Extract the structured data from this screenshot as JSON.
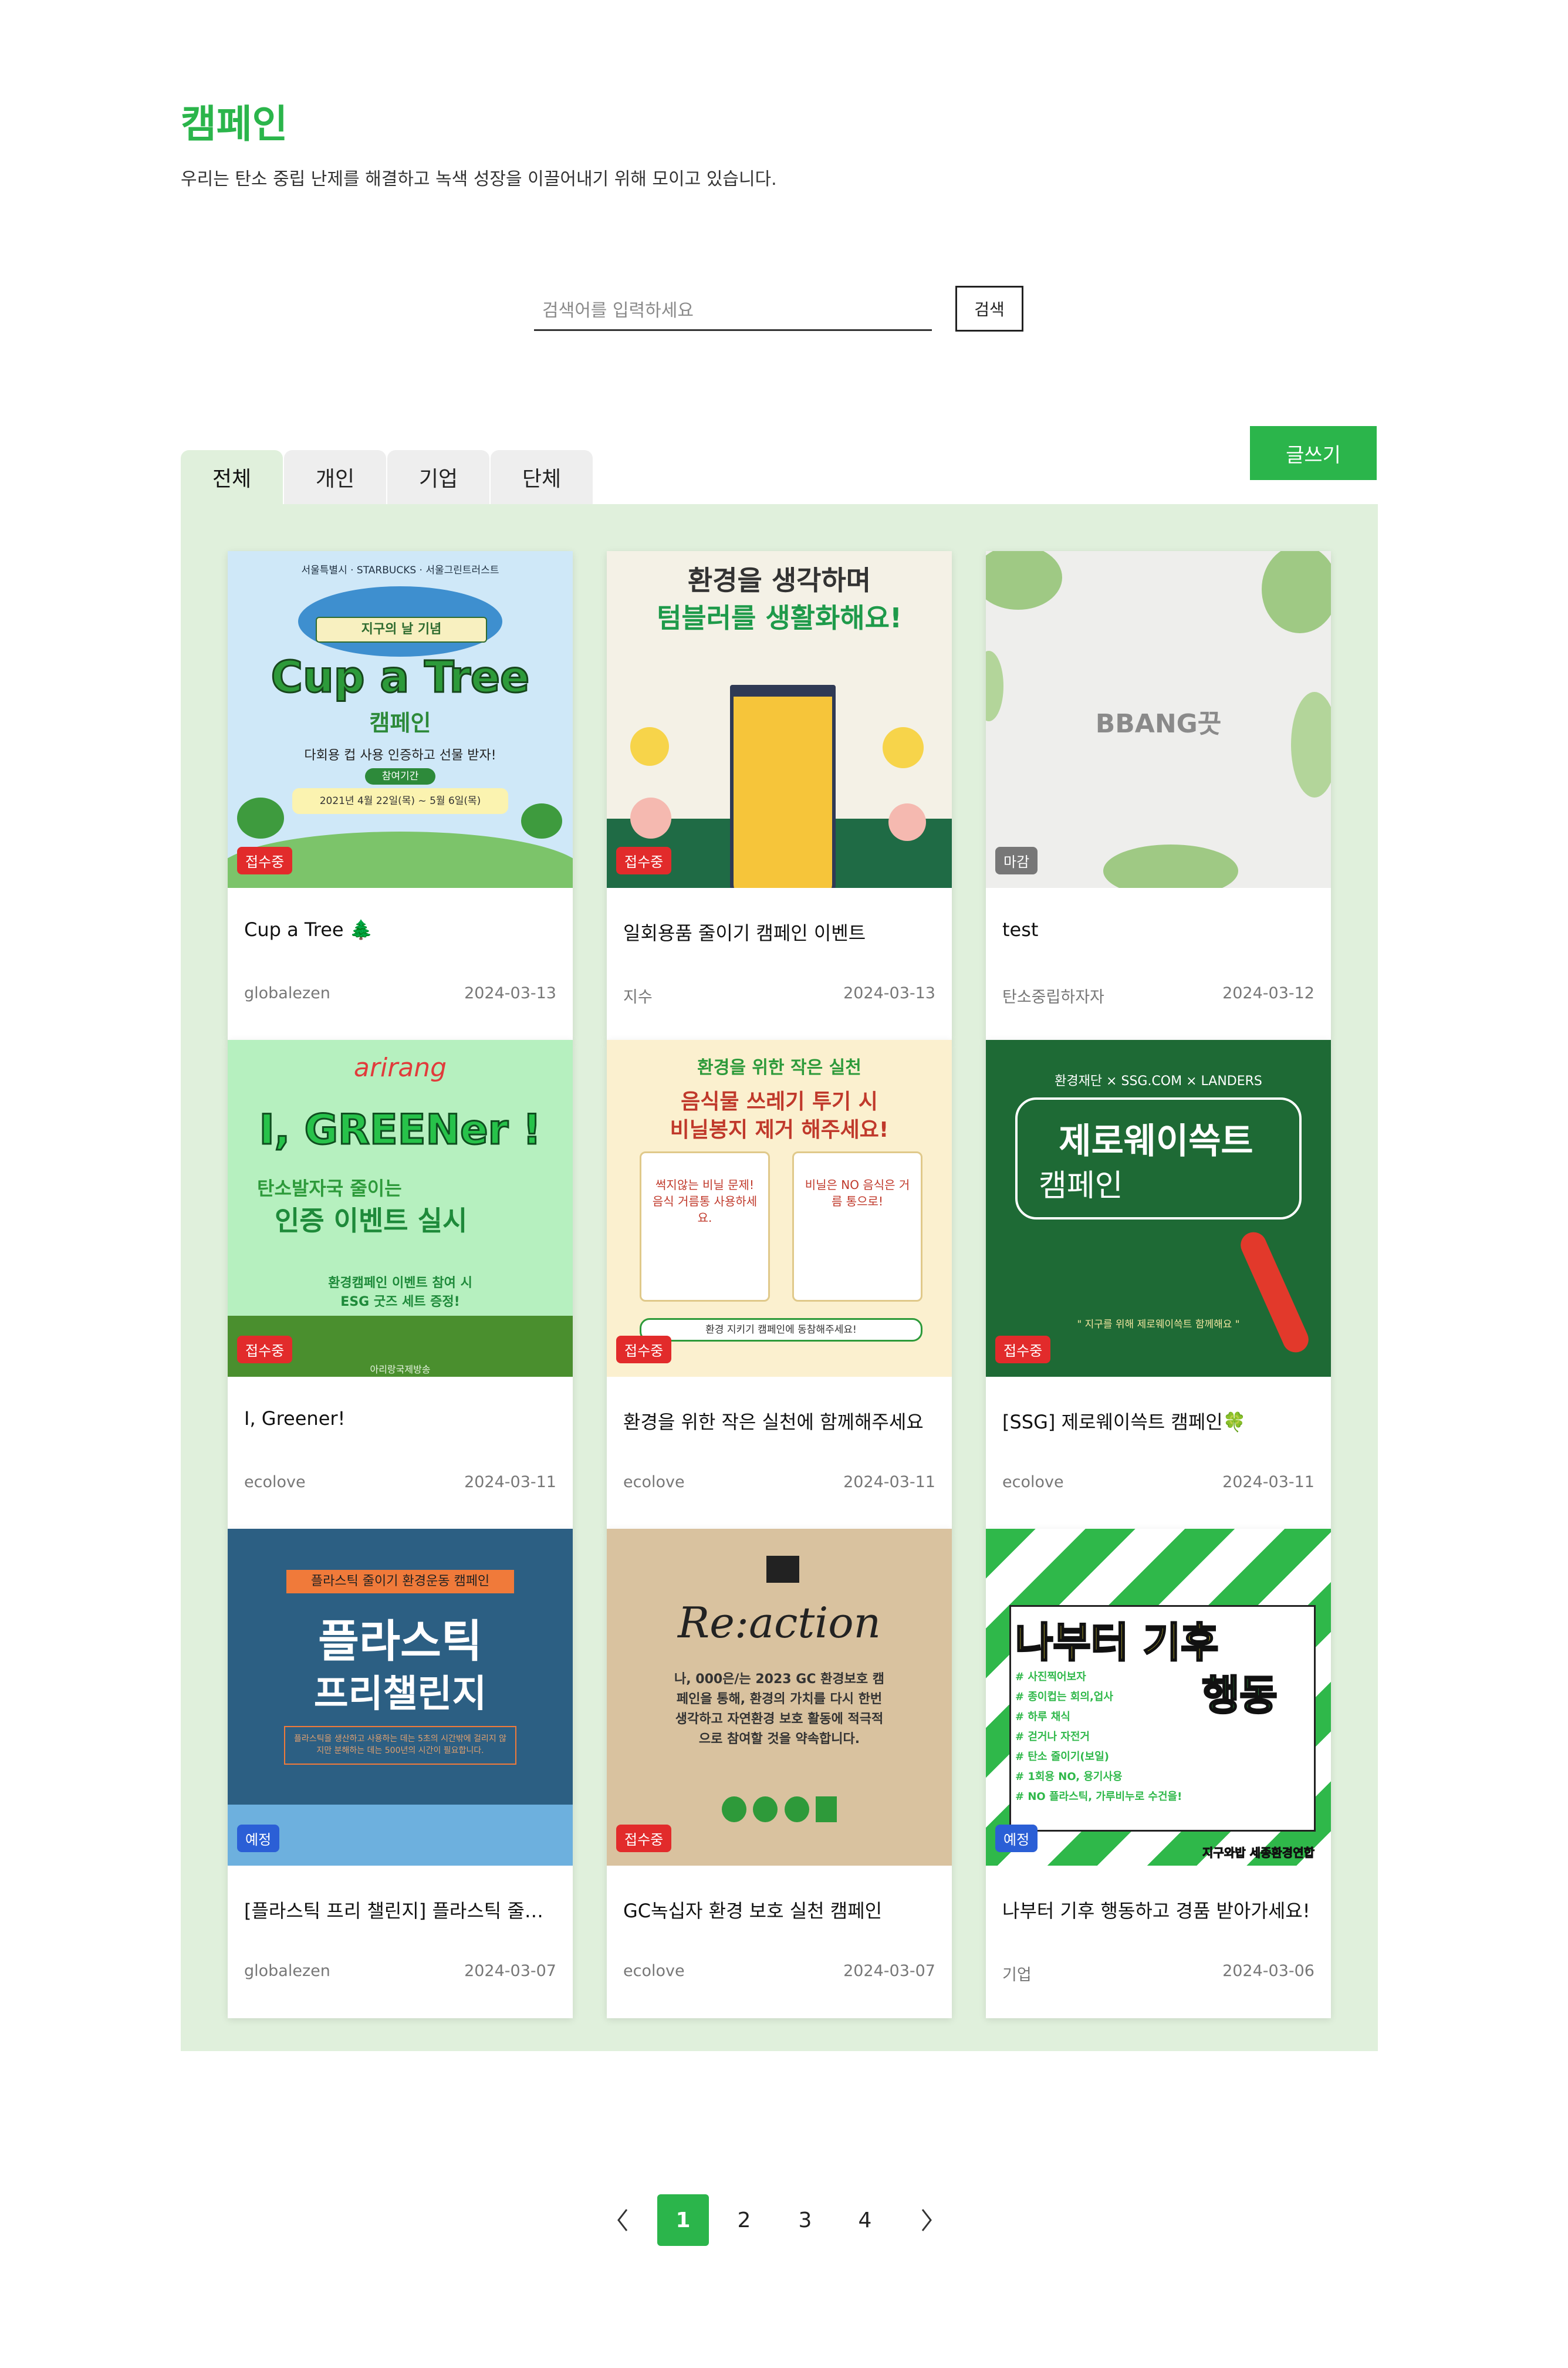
{
  "header": {
    "title": "캠페인",
    "subtitle": "우리는 탄소 중립 난제를 해결하고 녹색 성장을 이끌어내기 위해 모이고 있습니다."
  },
  "search": {
    "placeholder": "검색어를 입력하세요",
    "button": "검색"
  },
  "write_button": "글쓰기",
  "tabs": [
    "전체",
    "개인",
    "기업",
    "단체"
  ],
  "active_tab": "전체",
  "colors": {
    "accent": "#2bb54b",
    "panel": "#e0f0dc",
    "badge_open": "#e22b2b",
    "badge_closed": "#777777",
    "badge_planned": "#2b5fd6"
  },
  "cards": [
    {
      "status": "접수중",
      "title": "Cup a Tree 🌲",
      "author": "globalezen",
      "date": "2024-03-13",
      "thumb": {
        "logos": "서울특별시 · STARBUCKS · 서울그린트러스트",
        "ribbon": "지구의 날 기념",
        "headline": "Cup a Tree",
        "sub": "캠페인",
        "desc": "다회용 컵 사용 인증하고 선물 받자!",
        "period_label": "참여기간",
        "period": "2021년 4월 22일(목) ~ 5월 6일(목)"
      }
    },
    {
      "status": "접수중",
      "title": "일회용품 줄이기 캠페인 이벤트",
      "author": "지수",
      "date": "2024-03-13",
      "thumb": {
        "line1": "환경을 생각하며",
        "line2": "텀블러를 생활화해요!"
      }
    },
    {
      "status": "마감",
      "title": "test",
      "author": "탄소중립하자자",
      "date": "2024-03-12",
      "thumb": {
        "brand": "BBANG끗"
      }
    },
    {
      "status": "접수중",
      "title": "I, Greener!",
      "author": "ecolove",
      "date": "2024-03-11",
      "thumb": {
        "brand": "arirang",
        "headline": "I, GREENer !",
        "line1": "탄소발자국 줄이는",
        "line2": "인증 이벤트 실시",
        "line3": "환경캠페인 이벤트 참여 시",
        "line4": "ESG 굿즈 세트 증정!",
        "footer": "아리랑국제방송"
      }
    },
    {
      "status": "접수중",
      "title": "환경을 위한 작은 실천에 함께해주세요",
      "author": "ecolove",
      "date": "2024-03-11",
      "thumb": {
        "top": "환경을 위한 작은 실천",
        "line1": "음식물 쓰레기 투기 시",
        "line2": "비닐봉지 제거 해주세요!",
        "tip1": "썩지않는 비닐 문제! 음식 거름통 사용하세요.",
        "tip2": "비닐은 NO 음식은 거름 통으로!",
        "footer": "환경 지키기 캠페인에 동참해주세요!"
      }
    },
    {
      "status": "접수중",
      "title": "[SSG] 제로웨이쓱트 캠페인🍀",
      "author": "ecolove",
      "date": "2024-03-11",
      "thumb": {
        "partners": "환경재단 × SSG.COM × LANDERS",
        "headline": "제로웨이쓱트",
        "sub": "캠페인",
        "slogan": "\" 지구를 위해 제로웨이쓱트 함께해요 \""
      }
    },
    {
      "status": "예정",
      "title": "[플라스틱 프리 챌린지] 플라스틱 줄이기 환경운동 캠페인",
      "author": "globalezen",
      "date": "2024-03-07",
      "thumb": {
        "tag": "플라스틱 줄이기 환경운동 캠페인",
        "line1": "플라스틱",
        "line2": "프리챌린지",
        "note": "플라스틱을 생산하고 사용하는 데는 5초의 시간밖에 걸리지 않지만 분해하는 데는 500년의 시간이 필요합니다."
      }
    },
    {
      "status": "접수중",
      "title": "GC녹십자 환경 보호 실천 캠페인",
      "author": "ecolove",
      "date": "2024-03-07",
      "thumb": {
        "headline": "Re:action",
        "pledge": "나, 000은/는 2023 GC 환경보호 캠페인을 통해, 환경의 가치를 다시 한번 생각하고 자연환경 보호 활동에 적극적으로 참여할 것을 약속합니다."
      }
    },
    {
      "status": "예정",
      "title": "나부터 기후 행동하고 경품 받아가세요!",
      "author": "기업",
      "date": "2024-03-06",
      "thumb": {
        "line1": "나부터 기후",
        "line2": "행동",
        "items": [
          "# 사진찍어보자",
          "# 종이컵는 회의,업사",
          "# 하루 채식",
          "# 걷거나 자전거",
          "# 탄소 줄이기(보일)",
          "# 1회용 NO, 용기사용",
          "# NO 플라스틱, 가루비누로 수건을!"
        ],
        "footer": "지구와밥 세종환경연합"
      }
    }
  ],
  "pagination": {
    "pages": [
      "1",
      "2",
      "3",
      "4"
    ],
    "current": "1"
  }
}
